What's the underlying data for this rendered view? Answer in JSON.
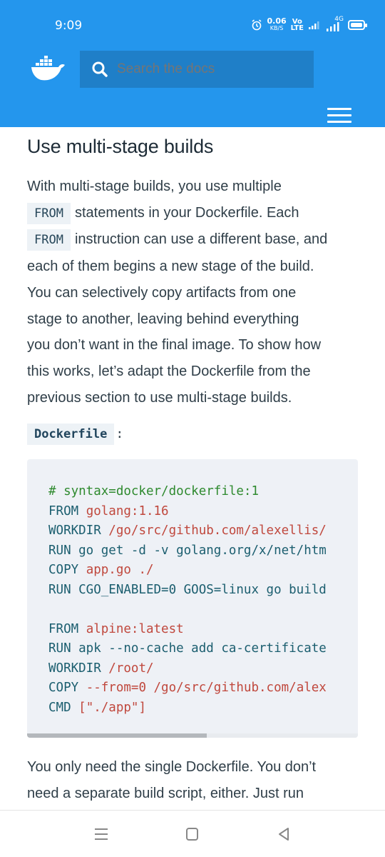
{
  "status_bar": {
    "time": "9:09",
    "net_speed": "0.06",
    "net_unit": "KB/S",
    "volte_top": "Vo",
    "volte_bottom": "LTE",
    "network": "4G"
  },
  "header": {
    "search_placeholder": "Search the docs",
    "brand_color": "#2496ed"
  },
  "article": {
    "title": "Use multi-stage builds",
    "para1": {
      "line1": "With multi-stage builds, you use multiple",
      "code1": "FROM",
      "line2": "statements in your Dockerfile. Each",
      "code2": "FROM",
      "line3": "instruction can use a different base, and",
      "rest": [
        "each of them begins a new stage of the build.",
        "You can selectively copy artifacts from one",
        "stage to another, leaving behind everything",
        "you don’t want in the final image. To show how",
        "this works, let’s adapt the Dockerfile from the",
        "previous section to use multi-stage builds."
      ]
    },
    "file_label": "Dockerfile",
    "file_colon": ":",
    "code": [
      {
        "kw": "# syntax=docker/dockerfile:1",
        "val": "",
        "type": "comment"
      },
      {
        "kw": "FROM ",
        "val": "golang:1.16",
        "type": "kv"
      },
      {
        "kw": "WORKDIR ",
        "val": "/go/src/github.com/alexellis/",
        "type": "kv"
      },
      {
        "kw": "RUN go get -d -v golang.org/x/net/htm",
        "val": "",
        "type": "plain"
      },
      {
        "kw": "COPY ",
        "val": "app.go ./",
        "type": "kv"
      },
      {
        "kw": "RUN CGO_ENABLED=0 GOOS=linux go build",
        "val": "",
        "type": "plain"
      },
      {
        "kw": "",
        "val": "",
        "type": "blank"
      },
      {
        "kw": "FROM ",
        "val": "alpine:latest",
        "type": "kv"
      },
      {
        "kw": "RUN apk --no-cache add ca-certificate",
        "val": "",
        "type": "plain"
      },
      {
        "kw": "WORKDIR ",
        "val": "/root/",
        "type": "kv"
      },
      {
        "kw": "COPY ",
        "val": "--from=0 /go/src/github.com/alex",
        "type": "kv"
      },
      {
        "kw": "CMD ",
        "val": "[\"./app\"]",
        "type": "kv"
      }
    ],
    "after": [
      "You only need the single Dockerfile. You don’t",
      "need a separate build script, either. Just run"
    ]
  },
  "icons": {
    "logo": "docker-whale-icon",
    "search": "search-icon",
    "menu": "hamburger-menu-icon",
    "alarm": "alarm-icon",
    "battery": "battery-icon"
  }
}
